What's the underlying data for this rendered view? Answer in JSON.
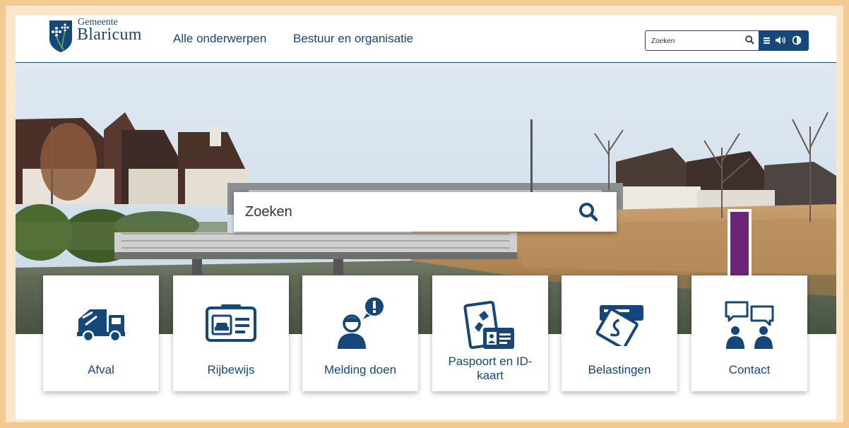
{
  "brand": {
    "small": "Gemeente",
    "name": "Blaricum"
  },
  "nav": {
    "item1": "Alle onderwerpen",
    "item2": "Bestuur en organisatie"
  },
  "top_search": {
    "placeholder": "Zoeken"
  },
  "hero_search": {
    "placeholder": "Zoeken"
  },
  "tiles": [
    {
      "label": "Afval",
      "icon": "garbage-truck-icon"
    },
    {
      "label": "Rijbewijs",
      "icon": "drivers-license-icon"
    },
    {
      "label": "Melding doen",
      "icon": "person-alert-icon"
    },
    {
      "label": "Paspoort en ID-kaart",
      "icon": "passport-id-icon"
    },
    {
      "label": "Belastingen",
      "icon": "tax-card-icon"
    },
    {
      "label": "Contact",
      "icon": "contact-people-icon"
    }
  ],
  "colors": {
    "brand": "#15477a",
    "arrow": "#6b2575",
    "frame": "#f3c98f"
  }
}
